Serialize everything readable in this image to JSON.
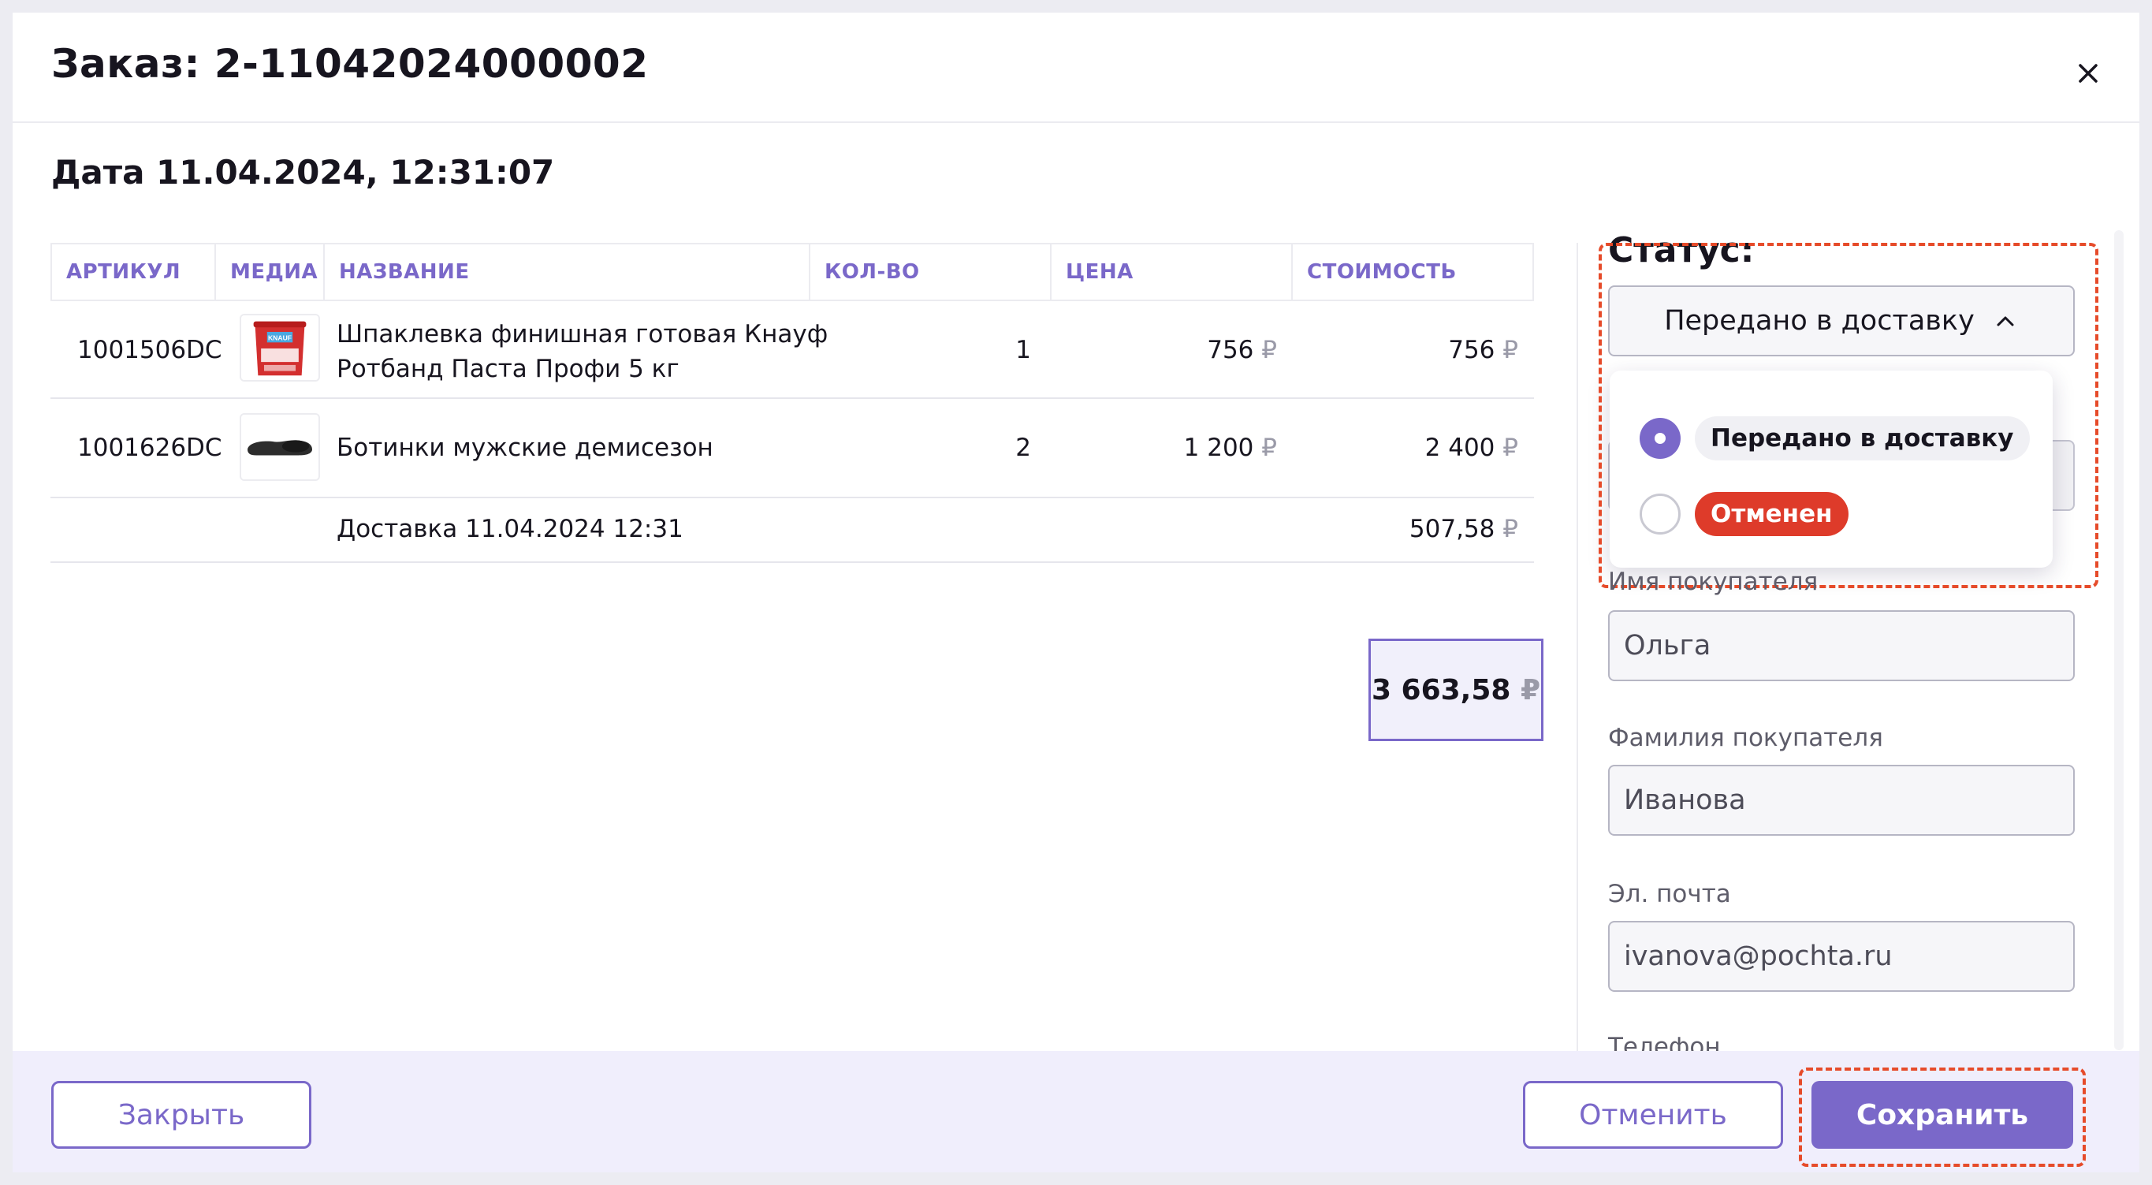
{
  "modal": {
    "title": "Заказ: 2-11042024000002",
    "date": "Дата 11.04.2024, 12:31:07"
  },
  "table": {
    "headers": [
      "АРТИКУЛ",
      "МЕДИА",
      "НАЗВАНИЕ",
      "КОЛ-ВО",
      "ЦЕНА",
      "СТОИМОСТЬ"
    ],
    "rows": [
      {
        "sku": "1001506DC",
        "media": "bucket-product-image",
        "name_line1": "Шпаклевка финишная готовая Кнауф",
        "name_line2": "Ротбанд Паста Профи 5 кг",
        "qty": "1",
        "price": "756",
        "cost": "756"
      },
      {
        "sku": "1001626DC",
        "media": "boots-product-image",
        "name_line1": "Ботинки мужские демисезон",
        "name_line2": "",
        "qty": "2",
        "price": "1 200",
        "cost": "2 400"
      }
    ],
    "delivery": {
      "label": "Доставка 11.04.2024 12:31",
      "cost": "507,58"
    },
    "currency": "₽",
    "total": "3 663,58"
  },
  "status": {
    "label": "Статус:",
    "selected": "Передано в доставку",
    "options": [
      {
        "label": "Передано в доставку",
        "checked": true,
        "color": "#f0f0f4"
      },
      {
        "label": "Отменен",
        "checked": false,
        "color": "#de3b2a"
      }
    ]
  },
  "fields": {
    "first_name": {
      "label": "Имя покупателя",
      "value": "Ольга"
    },
    "last_name": {
      "label": "Фамилия покупателя",
      "value": "Иванова"
    },
    "email": {
      "label": "Эл. почта",
      "value": "ivanova@pochta.ru"
    },
    "phone": {
      "label": "Телефон"
    }
  },
  "footer": {
    "close": "Закрыть",
    "cancel": "Отменить",
    "save": "Сохранить"
  },
  "colors": {
    "accent": "#7a68c9",
    "danger": "#de3b2a",
    "highlight_dash": "#e64b2a"
  }
}
